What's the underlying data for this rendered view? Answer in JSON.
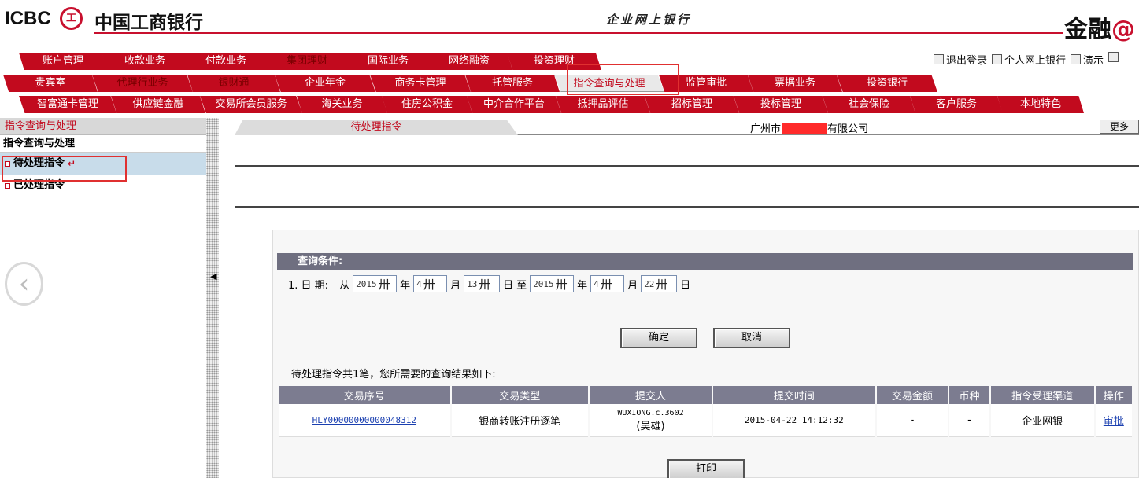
{
  "header": {
    "logo_en": "ICBC",
    "logo_mark": "工",
    "logo_cn": "中国工商银行",
    "ebank_title": "企业网上银行",
    "brand": "金融",
    "brand_at": "@"
  },
  "top_links": [
    {
      "label": "退出登录",
      "icon": "logout-icon"
    },
    {
      "label": "个人网上银行",
      "icon": "personal-bank-icon"
    },
    {
      "label": "演示",
      "icon": "demo-icon"
    }
  ],
  "nav": {
    "row1": [
      "账户管理",
      "收款业务",
      "付款业务",
      "集团理财",
      "国际业务",
      "网络融资",
      "投资理财"
    ],
    "row2": [
      "贵宾室",
      "代理行业务",
      "银财通",
      "企业年金",
      "商务卡管理",
      "托管服务",
      "指令查询与处理",
      "监管审批",
      "票据业务",
      "投资银行"
    ],
    "row3": [
      "智富通卡管理",
      "供应链金融",
      "交易所会员服务",
      "海关业务",
      "住房公积金",
      "中介合作平台",
      "抵押品评估",
      "招标管理",
      "投标管理",
      "社会保险",
      "客户服务",
      "本地特色"
    ]
  },
  "sidebar": {
    "header": "指令查询与处理",
    "sub": "指令查询与处理",
    "items": [
      {
        "label": "待处理指令",
        "selected": true
      },
      {
        "label": "已处理指令",
        "selected": false
      }
    ]
  },
  "main": {
    "tab": "待处理指令",
    "company_prefix": "广州市",
    "company_suffix": "有限公司",
    "more_label": "更多"
  },
  "query": {
    "heading": "查询条件:",
    "row_label": "1. 日  期:",
    "from": "从",
    "to": "至",
    "year_unit": "年",
    "month_unit": "月",
    "day_unit": "日",
    "start_year": "2015",
    "start_month": "4",
    "start_day": "13",
    "end_year": "2015",
    "end_month": "4",
    "end_day": "22",
    "picker_glyph": "卅",
    "ok_label": "确定",
    "cancel_label": "取消"
  },
  "results": {
    "summary": "待处理指令共1笔，您所需要的查询结果如下:",
    "columns": [
      "交易序号",
      "交易类型",
      "提交人",
      "提交时间",
      "交易金额",
      "币种",
      "指令受理渠道",
      "操作"
    ],
    "rows": [
      {
        "serial": "HLY00000000000048312",
        "type": "银商转账注册逐笔",
        "submitter_id": "WUXIONG.c.3602",
        "submitter_name": "(吴雄)",
        "time": "2015-04-22 14:12:32",
        "amount": "-",
        "currency": "-",
        "channel": "企业网银",
        "action": "审批"
      }
    ],
    "print_label": "打印"
  },
  "colors": {
    "brand_red": "#c20a1e",
    "table_header": "#7c7c90",
    "query_header": "#6f6f80",
    "selected_row": "#c8dcea",
    "highlight_box": "#e03030"
  }
}
